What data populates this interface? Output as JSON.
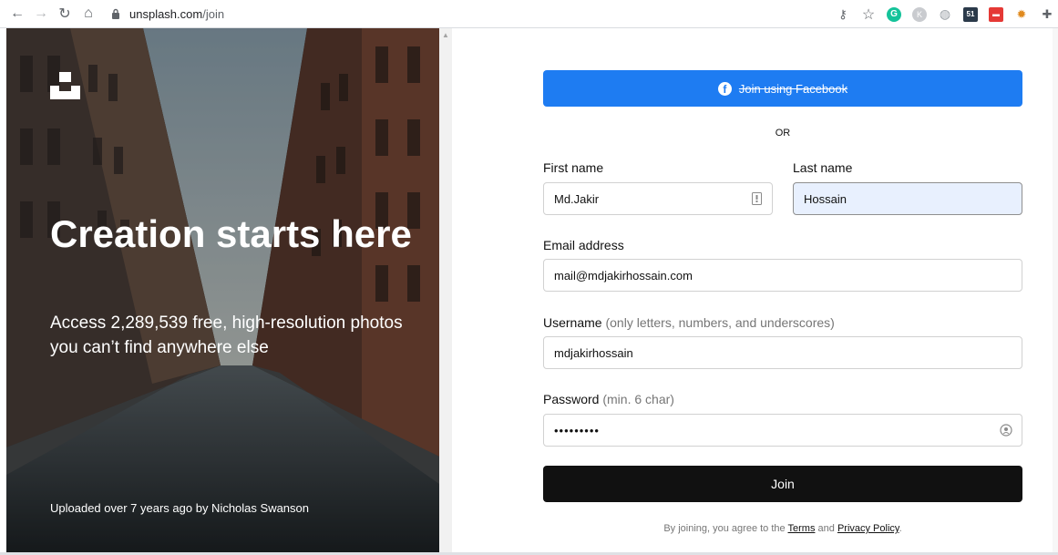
{
  "browser": {
    "url_host": "unsplash.com",
    "url_path": "/join"
  },
  "hero": {
    "title": "Creation starts here",
    "subtitle": "Access 2,289,539 free, high-resolution photos you can’t find anywhere else",
    "credit": "Uploaded over 7 years ago by Nicholas Swanson"
  },
  "form": {
    "facebook_label": "Join using Facebook",
    "or_label": "OR",
    "first_name": {
      "label": "First name",
      "value": "Md.Jakir"
    },
    "last_name": {
      "label": "Last name",
      "value": "Hossain"
    },
    "email": {
      "label": "Email address",
      "value": "mail@mdjakirhossain.com"
    },
    "username": {
      "label": "Username",
      "hint": "(only letters, numbers, and underscores)",
      "value": "mdjakirhossain"
    },
    "password": {
      "label": "Password",
      "hint": "(min. 6 char)",
      "value": "•••••••••"
    },
    "join_label": "Join",
    "legal_prefix": "By joining, you agree to the",
    "terms_label": "Terms",
    "and_label": "and",
    "privacy_label": "Privacy Policy",
    "legal_suffix": "."
  },
  "colors": {
    "facebook": "#1e7cf2",
    "join": "#111111",
    "autofill": "#e8f0fe"
  },
  "icons": [
    "back-arrow-icon",
    "forward-arrow-icon",
    "reload-icon",
    "home-icon",
    "lock-icon",
    "key-icon",
    "star-icon",
    "grammarly-icon",
    "extension-icon",
    "puzzle-icon",
    "facebook-icon",
    "unsplash-logo-icon",
    "contact-card-icon",
    "password-eye-icon"
  ]
}
